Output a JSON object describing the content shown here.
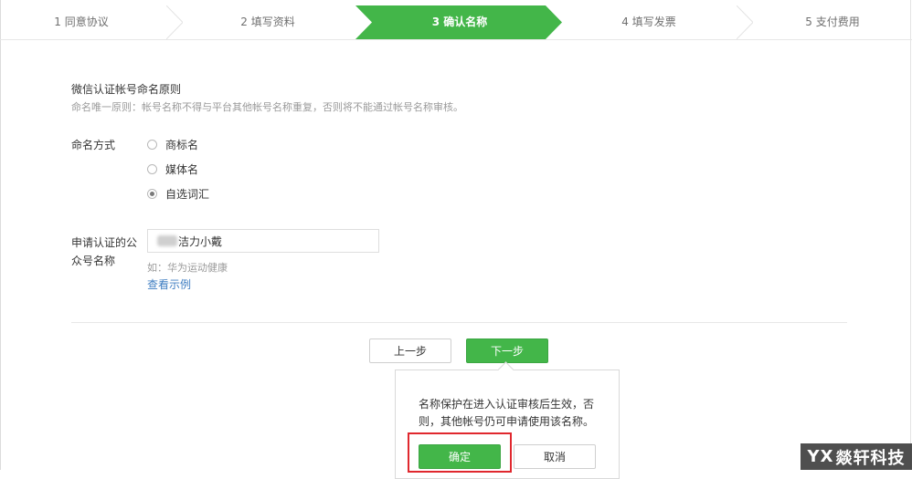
{
  "stepper": {
    "steps": [
      {
        "label": "1 同意协议",
        "active": false
      },
      {
        "label": "2 填写资料",
        "active": false
      },
      {
        "label": "3 确认名称",
        "active": true
      },
      {
        "label": "4 填写发票",
        "active": false
      },
      {
        "label": "5 支付费用",
        "active": false
      }
    ],
    "active_color": "#43b649"
  },
  "naming_rules": {
    "title": "微信认证帐号命名原则",
    "description": "命名唯一原则：帐号名称不得与平台其他帐号名称重复，否则将不能通过帐号名称审核。"
  },
  "naming_method": {
    "label": "命名方式",
    "options": [
      {
        "label": "商标名",
        "checked": false
      },
      {
        "label": "媒体名",
        "checked": false
      },
      {
        "label": "自选词汇",
        "checked": true
      }
    ]
  },
  "account_name": {
    "label_line1": "申请认证的公",
    "label_line2": "众号名称",
    "value": "洁力小戴",
    "hint": "如：华为运动健康",
    "example_link": "查看示例"
  },
  "actions": {
    "prev_label": "上一步",
    "next_label": "下一步"
  },
  "popover": {
    "message": "名称保护在进入认证审核后生效，否则，其他帐号仍可申请使用该名称。",
    "confirm_label": "确定",
    "cancel_label": "取消"
  },
  "watermark": {
    "logo": "YX",
    "text": "燚轩科技"
  },
  "colors": {
    "primary_green": "#43b649",
    "link_blue": "#3f7ec2",
    "highlight_red": "#e0282e"
  }
}
